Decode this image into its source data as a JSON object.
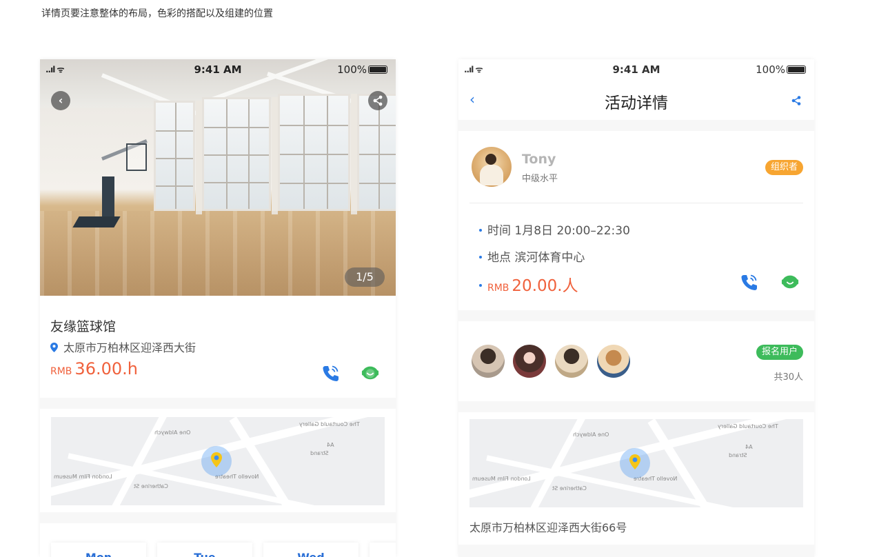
{
  "caption": "详情页要注意整体的布局，色彩的搭配以及组建的位置",
  "status": {
    "time": "9:41 AM",
    "battery": "100%",
    "signal": "..ıl ᯤ"
  },
  "left": {
    "image_counter": "1/5",
    "venue_name": "友缘篮球馆",
    "address": "太原市万柏林区迎泽西大街",
    "price_currency": "RMB",
    "price_value": "36.00.h",
    "map_labels": [
      "One Aldwych",
      "The Courtauld Gallery",
      "London Film Museum",
      "Novello Theatre",
      "Strand",
      "A4",
      "Catherine St"
    ],
    "days": [
      "Mon",
      "Tue",
      "Wed"
    ]
  },
  "right": {
    "title": "活动详情",
    "back": "‹",
    "organizer": {
      "name": "Tony",
      "level": "中级水平",
      "badge": "组织者"
    },
    "time_label": "时间 1月8日 20:00–22:30",
    "place_label": "地点 滨河体育中心",
    "price_currency": "RMB",
    "price_value": "20.00.人",
    "users_badge": "报名用户",
    "users_count": "共30人",
    "map_address": "太原市万柏林区迎泽西大街66号"
  },
  "colors": {
    "accent_blue": "#2a7ae4",
    "price_red": "#f0613c",
    "badge_orange": "#f7a531",
    "badge_green": "#3dbb5b"
  },
  "icons": [
    "back-icon",
    "share-icon",
    "location-pin-icon",
    "phone-icon",
    "chat-icon",
    "map-marker-icon"
  ]
}
